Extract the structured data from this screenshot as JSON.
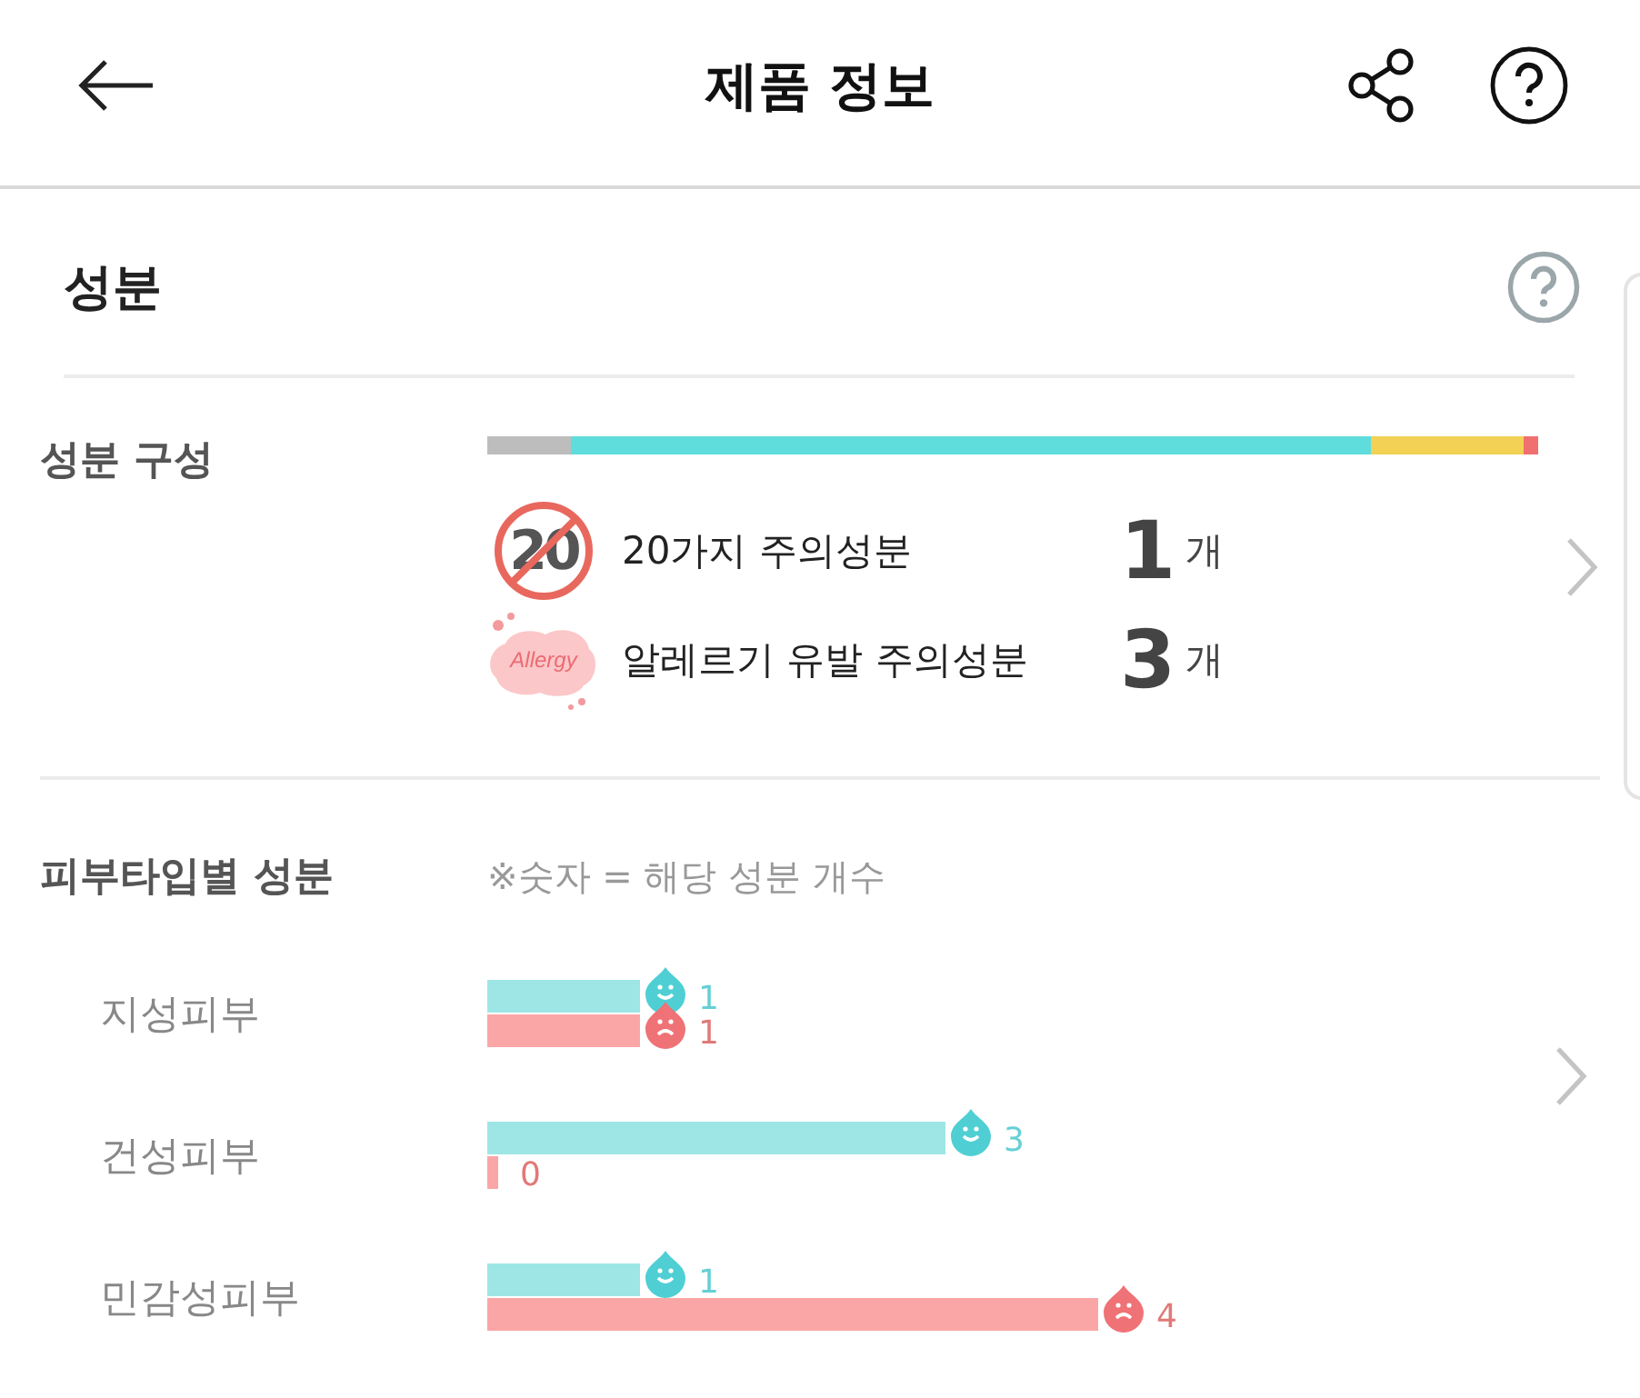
{
  "header": {
    "title": "제품 정보"
  },
  "ingredients": {
    "title": "성분",
    "composition": {
      "label": "성분 구성",
      "cautions": [
        {
          "kind": "twenty",
          "badge": "20",
          "label": "20가지 주의성분",
          "count": "1",
          "unit": "개"
        },
        {
          "kind": "allergy",
          "badge": "Allergy",
          "label": "알레르기 유발 주의성분",
          "count": "3",
          "unit": "개"
        }
      ]
    },
    "skin_types": {
      "label": "피부타입별 성분",
      "note": "※숫자 = 해당 성분 개수",
      "chart_data": {
        "type": "bar",
        "orientation": "horizontal",
        "categories": [
          "지성피부",
          "건성피부",
          "민감성피부"
        ],
        "data_labels": true,
        "series": [
          {
            "color": "#9ee6e6",
            "values": [
              1,
              3,
              1
            ]
          },
          {
            "color": "#fba6a6",
            "values": [
              1,
              0,
              4
            ]
          }
        ]
      }
    }
  }
}
